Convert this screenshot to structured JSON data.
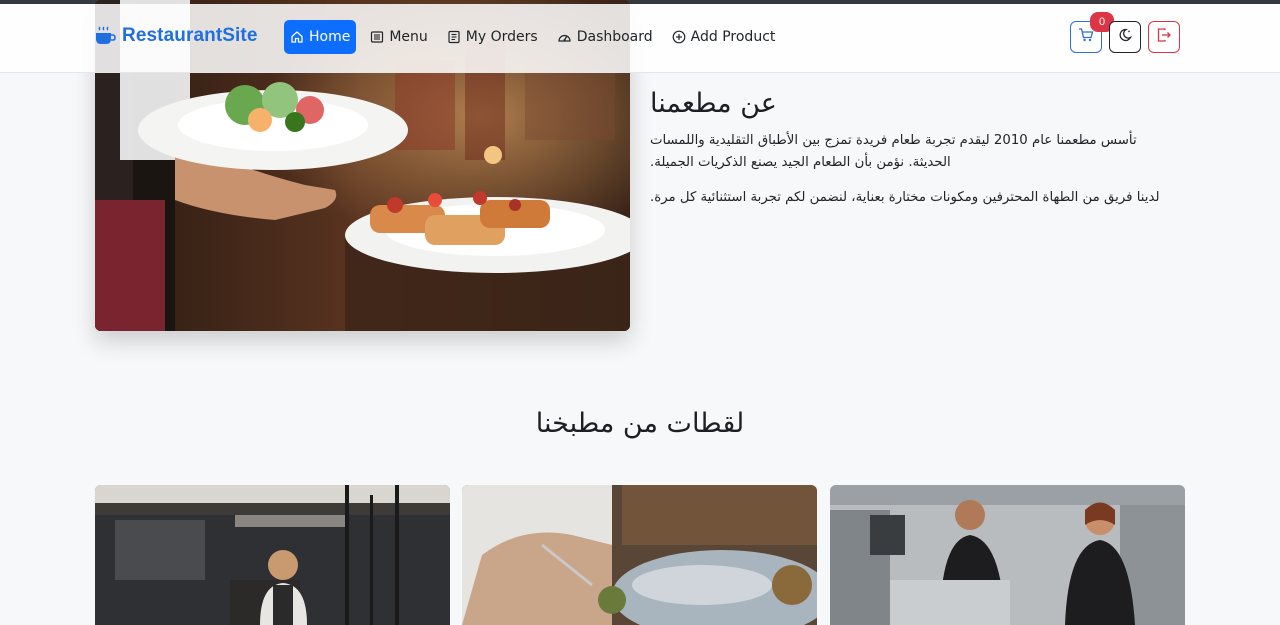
{
  "navbar": {
    "brand": "RestaurantSite",
    "links": [
      {
        "label": "Home",
        "icon": "house-icon",
        "active": true
      },
      {
        "label": "Menu",
        "icon": "menu-card-icon",
        "active": false
      },
      {
        "label": "My Orders",
        "icon": "receipt-icon",
        "active": false
      },
      {
        "label": "Dashboard",
        "icon": "speedometer-icon",
        "active": false
      },
      {
        "label": "Add Product",
        "icon": "plus-circle-icon",
        "active": false
      }
    ],
    "cart_count": "0"
  },
  "about": {
    "title": "عن مطعمنا",
    "paragraph_1": "تأسس مطعمنا عام 2010 ليقدم تجربة طعام فريدة تمزج بين الأطباق التقليدية واللمسات الحديثة. نؤمن بأن الطعام الجيد يصنع الذكريات الجميلة.",
    "paragraph_2": "لدينا فريق من الطهاة المحترفين ومكونات مختارة بعناية، لنضمن لكم تجربة استثنائية كل مرة."
  },
  "gallery": {
    "title": "لقطات من مطبخنا"
  },
  "colors": {
    "primary": "#0d6efd",
    "brand": "#1f6fe0",
    "danger": "#dc3545",
    "page_bg": "#f7f8fa"
  }
}
